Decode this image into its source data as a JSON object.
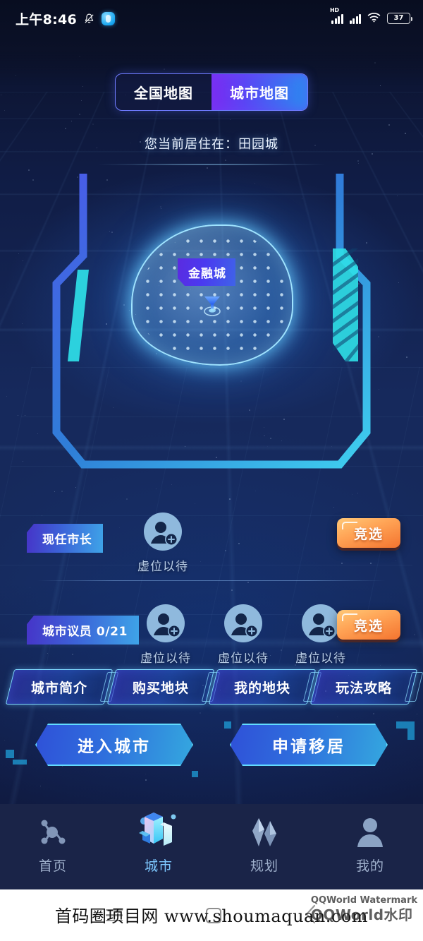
{
  "status_bar": {
    "time": "上午8:46",
    "bell_icon": "bell-muted-icon",
    "app_icon": "app-badge-icon",
    "hd_label": "HD",
    "signal_icon": "signal-bars-icon",
    "signal2_icon": "signal-bars-icon",
    "wifi_icon": "wifi-icon",
    "battery_level": "37"
  },
  "map_toggle": {
    "options": [
      {
        "label": "全国地图",
        "active": false
      },
      {
        "label": "城市地图",
        "active": true
      }
    ]
  },
  "residence": {
    "text": "您当前居住在：田园城"
  },
  "map": {
    "region_label": "金融城",
    "marker_icon": "location-pin-icon"
  },
  "mayor_section": {
    "badge": "现任市长",
    "slots": [
      {
        "label": "虚位以待",
        "avatar_icon": "add-user-avatar-icon"
      }
    ],
    "vote_button": "竞选"
  },
  "council_section": {
    "badge": "城市议员 0/21",
    "slots": [
      {
        "label": "虚位以待",
        "avatar_icon": "add-user-avatar-icon"
      },
      {
        "label": "虚位以待",
        "avatar_icon": "add-user-avatar-icon"
      },
      {
        "label": "虚位以待",
        "avatar_icon": "add-user-avatar-icon"
      }
    ],
    "vote_button": "竞选"
  },
  "chips": [
    {
      "label": "城市简介"
    },
    {
      "label": "购买地块"
    },
    {
      "label": "我的地块"
    },
    {
      "label": "玩法攻略"
    }
  ],
  "actions": [
    {
      "label": "进入城市"
    },
    {
      "label": "申请移居"
    }
  ],
  "tabbar": [
    {
      "label": "首页",
      "icon": "molecule-icon",
      "active": false
    },
    {
      "label": "城市",
      "icon": "city-buildings-icon",
      "active": true
    },
    {
      "label": "规划",
      "icon": "diamond-icon",
      "active": false
    },
    {
      "label": "我的",
      "icon": "person-icon",
      "active": false
    }
  ],
  "android_nav": {
    "menu_icon": "menu-icon",
    "home_icon": "home-square-icon",
    "back_icon": "back-chevron-icon"
  },
  "watermark": {
    "main": "首码圈项目网 www.shoumaquan.com",
    "brand_line1": "QQWorld Watermark",
    "brand_line2": "QQWorld水印"
  },
  "colors": {
    "accent_cyan": "#62dcff",
    "accent_blue": "#2f6fdd",
    "accent_purple": "#5a46f5",
    "vote_orange": "#ffa355",
    "tabbar_bg": "#1a2448"
  }
}
